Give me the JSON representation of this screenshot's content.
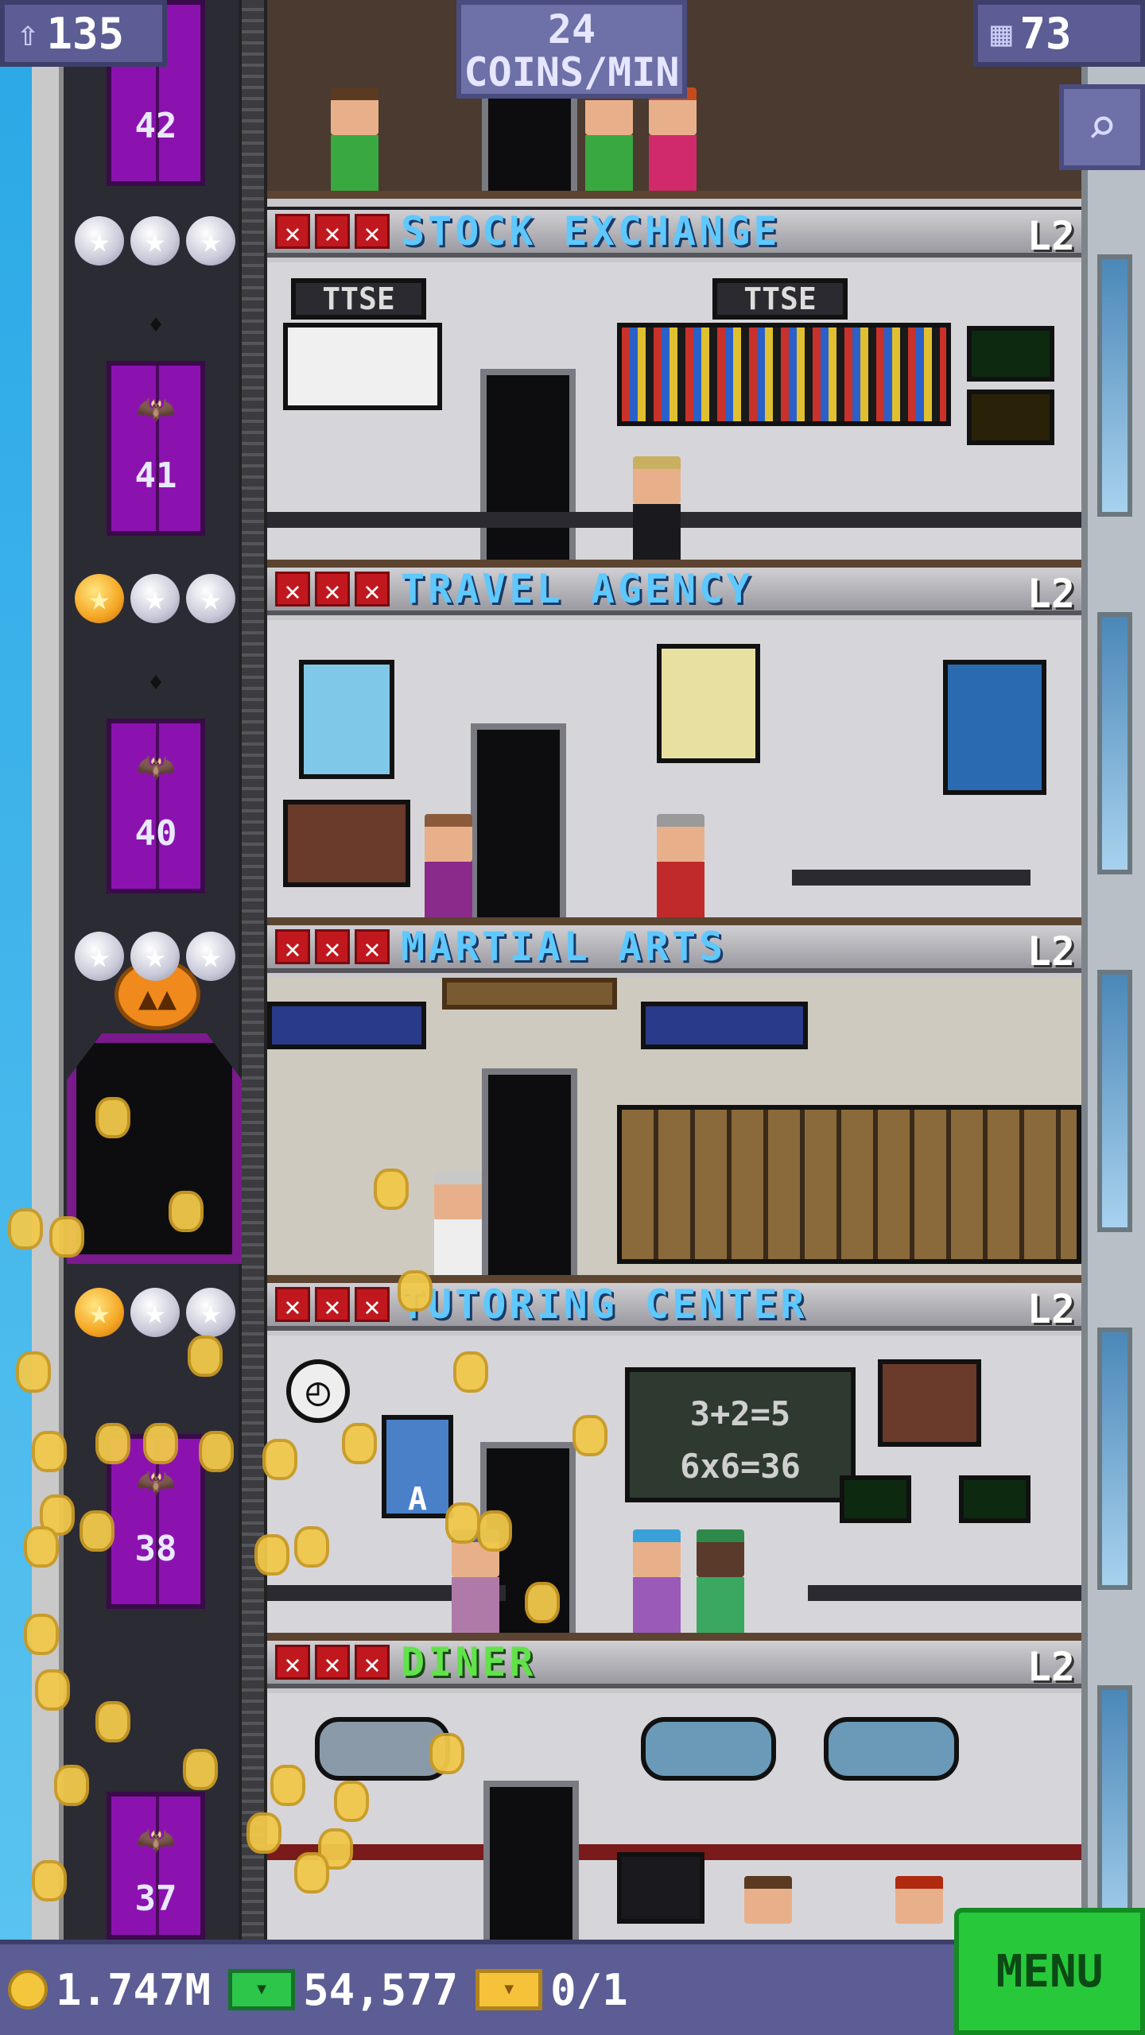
{
  "hud": {
    "population": "135",
    "coins_per_min_value": "24",
    "coins_per_min_label": "COINS/MIN",
    "floors_count": "73",
    "population_icon": "person-up-icon",
    "floors_icon": "building-icon",
    "zoom_icon": "magnifier-icon"
  },
  "elevator_numbers": [
    "42",
    "41",
    "40",
    "38",
    "37"
  ],
  "floors": [
    {
      "name": "STOCK EXCHANGE",
      "level": "L2",
      "stars": [
        "silver",
        "silver",
        "silver"
      ],
      "room_signs": [
        "TTSE",
        "TTSE"
      ]
    },
    {
      "name": "TRAVEL AGENCY",
      "level": "L2",
      "stars": [
        "gold",
        "silver",
        "silver"
      ]
    },
    {
      "name": "MARTIAL ARTS",
      "level": "L2",
      "stars": [
        "silver",
        "silver",
        "silver"
      ]
    },
    {
      "name": "TUTORING CENTER",
      "level": "L2",
      "stars": [
        "gold",
        "silver",
        "silver"
      ],
      "chalkboard": [
        "3+2=5",
        "6x6=36"
      ],
      "poster": "A"
    },
    {
      "name": "DINER",
      "level": "L2",
      "stars": []
    }
  ],
  "bottom_bar": {
    "coins": "1.747M",
    "bux": "54,577",
    "tickets": "0/1",
    "menu_label": "MENU"
  },
  "colors": {
    "hud": "#5b5d94",
    "elevator": "#8c12b0",
    "floor_name_service": "#5ec8ff",
    "floor_name_food": "#62e24a",
    "menu_button": "#27c93a",
    "coin": "#f1c84a"
  }
}
